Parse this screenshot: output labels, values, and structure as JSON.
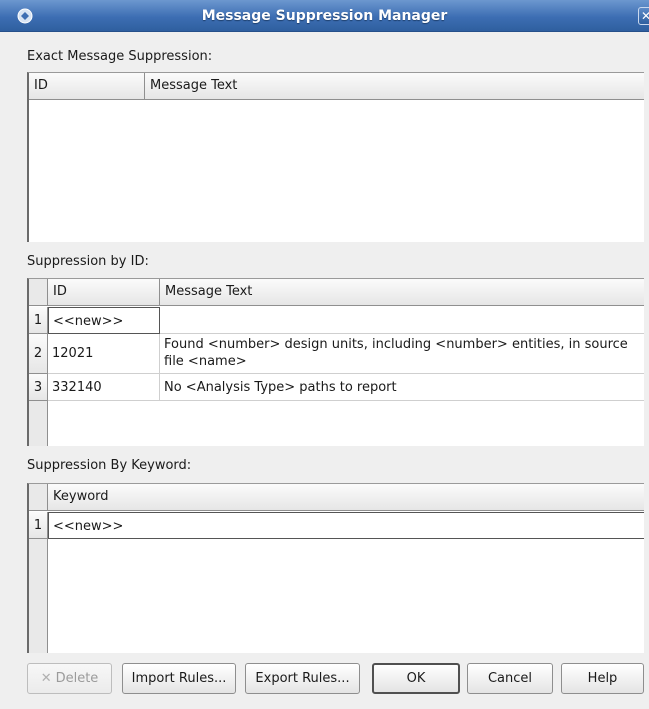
{
  "window": {
    "title": "Message Suppression Manager"
  },
  "sections": {
    "exact": {
      "label": "Exact Message Suppression:",
      "columns": [
        "ID",
        "Message Text"
      ]
    },
    "by_id": {
      "label": "Suppression by ID:",
      "columns": [
        "ID",
        "Message Text"
      ],
      "rows": [
        {
          "num": "1",
          "id": "<<new>>",
          "text": ""
        },
        {
          "num": "2",
          "id": "12021",
          "text": "Found <number> design units, including <number> entities, in source file <name>"
        },
        {
          "num": "3",
          "id": "332140",
          "text": "No <Analysis Type> paths to report"
        }
      ]
    },
    "by_keyword": {
      "label": "Suppression By Keyword:",
      "columns": [
        "Keyword"
      ],
      "rows": [
        {
          "num": "1",
          "keyword": "<<new>>"
        }
      ]
    }
  },
  "buttons": {
    "delete": "Delete",
    "import": "Import Rules...",
    "export": "Export Rules...",
    "ok": "OK",
    "cancel": "Cancel",
    "help": "Help"
  },
  "icons": {
    "app": "app-logo-icon",
    "close": "close-icon",
    "delete": "x-icon"
  }
}
